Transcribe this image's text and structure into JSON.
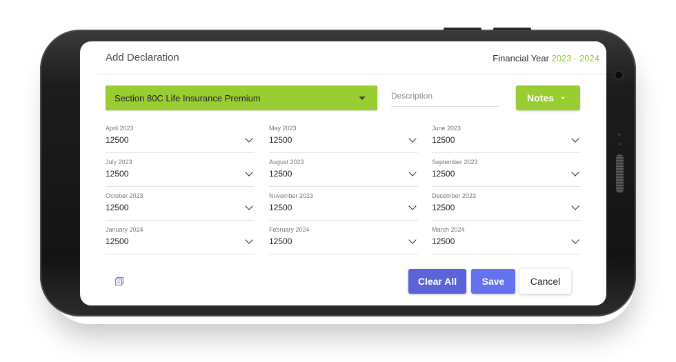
{
  "header": {
    "title": "Add Declaration",
    "fy_label": "Financial Year",
    "fy_value": "2023 - 2024"
  },
  "section_select": {
    "value": "Section 80C Life Insurance Premium"
  },
  "description": {
    "placeholder": "Description"
  },
  "notes_button": {
    "label": "Notes"
  },
  "months": [
    {
      "label": "April 2023",
      "value": "12500"
    },
    {
      "label": "May 2023",
      "value": "12500"
    },
    {
      "label": "June 2023",
      "value": "12500"
    },
    {
      "label": "July 2023",
      "value": "12500"
    },
    {
      "label": "August 2023",
      "value": "12500"
    },
    {
      "label": "September 2023",
      "value": "12500"
    },
    {
      "label": "October 2023",
      "value": "12500"
    },
    {
      "label": "November 2023",
      "value": "12500"
    },
    {
      "label": "December 2023",
      "value": "12500"
    },
    {
      "label": "January 2024",
      "value": "12500"
    },
    {
      "label": "February 2024",
      "value": "12500"
    },
    {
      "label": "March 2024",
      "value": "12500"
    }
  ],
  "actions": {
    "clear_all": "Clear All",
    "save": "Save",
    "cancel": "Cancel"
  },
  "colors": {
    "accent_green": "#9acd32",
    "year_green": "#8cc63f",
    "primary_blue": "#6472ef",
    "clear_blue": "#5b63d6"
  },
  "icons": [
    "chevron-down-icon",
    "copy-icon",
    "camera-icon"
  ]
}
